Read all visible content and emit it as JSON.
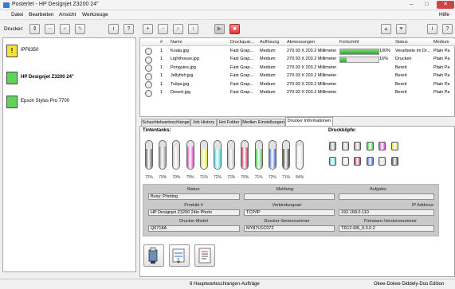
{
  "window": {
    "title": "Posterlet - HP Designjet Z3200 24\"",
    "minimize": "–",
    "maximize": "□",
    "close": "✕"
  },
  "menu": {
    "items": [
      "Datei",
      "Bearbeiten",
      "Ansicht",
      "Werkzeuge"
    ],
    "help": "Hilfe"
  },
  "printers_panel": {
    "label": "Drucker:",
    "items": [
      {
        "name": "iPF6350",
        "color": "#f5e23a",
        "mark": "!"
      },
      {
        "name": "HP Designjet Z3200 24\"",
        "color": "#5fd35f",
        "mark": ""
      },
      {
        "name": "Epson Stylus Pro 7700",
        "color": "#5fd35f",
        "mark": ""
      }
    ]
  },
  "toolbar": {
    "add": "+",
    "remove": "−",
    "search": "⌕",
    "info": "i",
    "play": "▶",
    "stop": "■",
    "up": "▲",
    "down": "▼"
  },
  "jobs": {
    "headers": [
      "#",
      "Name",
      "Druckqual...",
      "Auflösung",
      "Abmessungen",
      "Fortschritt",
      "Status",
      "Medium"
    ],
    "rows": [
      {
        "num": "1",
        "name": "Koala.jpg",
        "quality": "Fast Grap...",
        "resolution": "Medium",
        "size": "270.93 X 203.2 Millimeter",
        "progress": 1.0,
        "progress_text": "100%",
        "status": "Verarbeite im Dr...",
        "medium": "Plain Pa"
      },
      {
        "num": "1",
        "name": "Lighthouse.jpg",
        "quality": "Fast Grap...",
        "resolution": "Medium",
        "size": "270.93 X 203.2 Millimeter",
        "progress": 0.16,
        "progress_text": "16%",
        "status": "Drucken",
        "medium": "Plain Pa"
      },
      {
        "num": "1",
        "name": "Penguins.jpg",
        "quality": "Fast Grap...",
        "resolution": "Medium",
        "size": "270.93 X 203.2 Millimeter",
        "progress": null,
        "progress_text": "",
        "status": "Bereit",
        "medium": "Plain Pa"
      },
      {
        "num": "1",
        "name": "Jellyfish.jpg",
        "quality": "Fast Grap...",
        "resolution": "Medium",
        "size": "270.93 X 203.2 Millimeter",
        "progress": null,
        "progress_text": "",
        "status": "Bereit",
        "medium": "Plain Pa"
      },
      {
        "num": "1",
        "name": "Tulips.jpg",
        "quality": "Fast Grap...",
        "resolution": "Medium",
        "size": "270.93 X 203.2 Millimeter",
        "progress": null,
        "progress_text": "",
        "status": "Bereit",
        "medium": "Plain Pa"
      },
      {
        "num": "1",
        "name": "Desert.jpg",
        "quality": "Fast Grap...",
        "resolution": "Medium",
        "size": "270.93 X 203.2 Millimeter",
        "progress": null,
        "progress_text": "",
        "status": "Bereit",
        "medium": "Plain Pa"
      }
    ]
  },
  "tabs": [
    "Schachtelwarteschlange",
    "Job History",
    "Hot Folder",
    "Medien Einstellungen",
    "Drucker Informationen"
  ],
  "printer_info": {
    "ink_title": "Tintentanks:",
    "heads_title": "Druckköpfe:",
    "inks": [
      {
        "color": "#6e6e6e",
        "level": 0.72,
        "label": "72%"
      },
      {
        "color": "#9a9a9a",
        "level": 0.79,
        "label": "79%"
      },
      {
        "color": "#c9c9c9",
        "level": 0.79,
        "label": "79%"
      },
      {
        "color": "#e043c6",
        "level": 0.79,
        "label": "79%"
      },
      {
        "color": "#dfe24a",
        "level": 0.71,
        "label": "71%"
      },
      {
        "color": "#5bd3e8",
        "level": 0.72,
        "label": "72%"
      },
      {
        "color": "#b8b8b8",
        "level": 0.72,
        "label": "72%"
      },
      {
        "color": "#d1325d",
        "level": 0.76,
        "label": "76%"
      },
      {
        "color": "#4fc94f",
        "level": 0.71,
        "label": "71%"
      },
      {
        "color": "#4b6be0",
        "level": 0.72,
        "label": "72%"
      },
      {
        "color": "#4a4a4a",
        "level": 0.71,
        "label": "71%"
      },
      {
        "color": "#e2e2e2",
        "level": 0.84,
        "label": "84%"
      }
    ],
    "heads": [
      "#8a8a8a",
      "#b5b5b5",
      "#a0a0a0",
      "#4fc94f",
      "#e043c6",
      "#dfe24a",
      "#5bd3e8",
      "#d8d8d8",
      "#d1325d",
      "#4b6be0",
      "#cfcfcf",
      "#5a5a5a"
    ],
    "status_label": "Status:",
    "status_value": "Busy: Printing",
    "message_label": "Meldung:",
    "message_value": "",
    "task_label": "Aufgabe:",
    "task_value": "",
    "product_label": "Produkt #",
    "product_value": "HP Designjet Z3200 24in Photo",
    "connection_label": "Verbindungsart",
    "connection_value": "TCP/IP",
    "ip_label": "IP Address:",
    "ip_value": "192.168.0.110",
    "model_label": "Drucker Model",
    "model_value": "Q6718A",
    "serial_label": "Drucker-Seriennummer",
    "serial_value": "MY87U1C072",
    "firmware_label": "Firmware-Versionsnummer",
    "firmware_value": "TR12-RB_9.0.0.2"
  },
  "statusbar": {
    "queue": "6 Hauptwarteschlangen-Aufträge",
    "edition": "Okee-Dokee Diddely-Doo Edition"
  }
}
